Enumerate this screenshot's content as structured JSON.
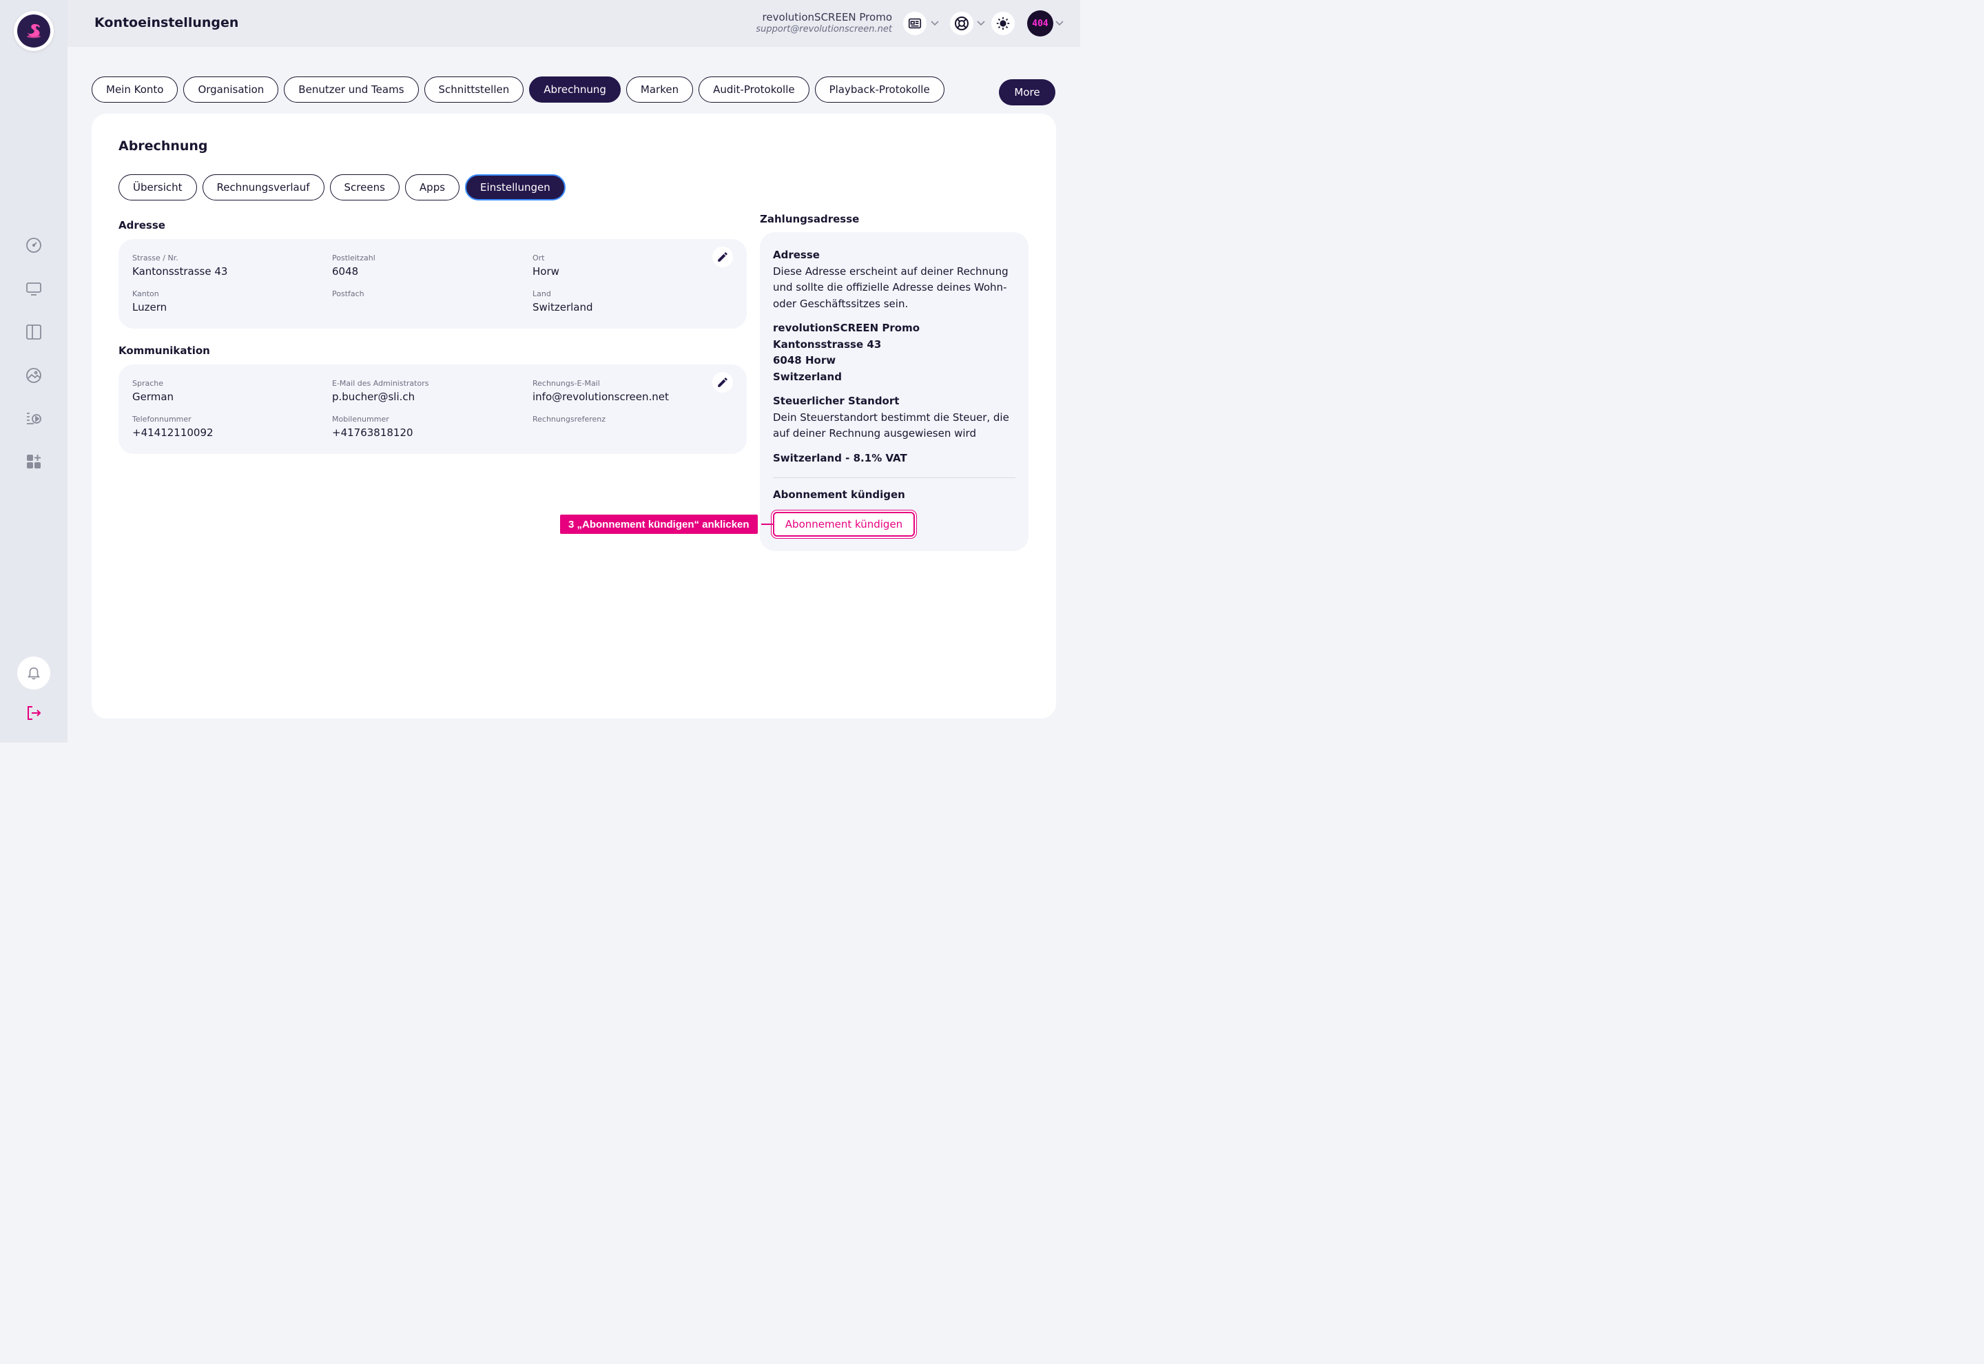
{
  "header": {
    "title": "Kontoeinstellungen",
    "account_name": "revolutionSCREEN Promo",
    "account_email": "support@revolutionscreen.net",
    "avatar_text": "404"
  },
  "top_tabs": [
    {
      "label": "Mein Konto",
      "active": false
    },
    {
      "label": "Organisation",
      "active": false
    },
    {
      "label": "Benutzer und Teams",
      "active": false
    },
    {
      "label": "Schnittstellen",
      "active": false
    },
    {
      "label": "Abrechnung",
      "active": true
    },
    {
      "label": "Marken",
      "active": false
    },
    {
      "label": "Audit-Protokolle",
      "active": false
    },
    {
      "label": "Playback-Protokolle",
      "active": false
    }
  ],
  "more_label": "More",
  "section": {
    "title": "Abrechnung",
    "sub_tabs": [
      {
        "label": "Übersicht",
        "active": false
      },
      {
        "label": "Rechnungsverlauf",
        "active": false
      },
      {
        "label": "Screens",
        "active": false
      },
      {
        "label": "Apps",
        "active": false
      },
      {
        "label": "Einstellungen",
        "active": true
      }
    ]
  },
  "address": {
    "title": "Adresse",
    "fields": {
      "street_label": "Strasse / Nr.",
      "street_value": "Kantonsstrasse 43",
      "zip_label": "Postleitzahl",
      "zip_value": "6048",
      "city_label": "Ort",
      "city_value": "Horw",
      "canton_label": "Kanton",
      "canton_value": "Luzern",
      "pobox_label": "Postfach",
      "pobox_value": "",
      "country_label": "Land",
      "country_value": "Switzerland"
    }
  },
  "communication": {
    "title": "Kommunikation",
    "fields": {
      "language_label": "Sprache",
      "language_value": "German",
      "admin_email_label": "E-Mail des Administrators",
      "admin_email_value": "p.bucher@sli.ch",
      "billing_email_label": "Rechnungs-E-Mail",
      "billing_email_value": "info@revolutionscreen.net",
      "phone_label": "Telefonnummer",
      "phone_value": "+41412110092",
      "mobile_label": "Mobilenummer",
      "mobile_value": "+41763818120",
      "billing_ref_label": "Rechnungsreferenz",
      "billing_ref_value": ""
    }
  },
  "payment_address": {
    "title": "Zahlungsadresse",
    "address_heading": "Adresse",
    "address_desc": "Diese Adresse erscheint auf deiner Rechnung und sollte die offizielle Adresse deines Wohn- oder Geschäftssitzes sein.",
    "lines": [
      "revolutionSCREEN Promo",
      "Kantonsstrasse 43",
      "6048 Horw",
      "Switzerland"
    ],
    "tax_heading": "Steuerlicher Standort",
    "tax_desc": "Dein Steuerstandort bestimmt die Steuer, die auf deiner Rechnung ausgewiesen wird",
    "tax_value": "Switzerland - 8.1% VAT",
    "cancel_heading": "Abonnement kündigen",
    "cancel_button": "Abonnement kündigen"
  },
  "annotation": {
    "text": "3  „Abonnement kündigen“ anklicken"
  },
  "colors": {
    "primary": "#24174a",
    "accent": "#e6007e",
    "background": "#f2f4f8"
  }
}
